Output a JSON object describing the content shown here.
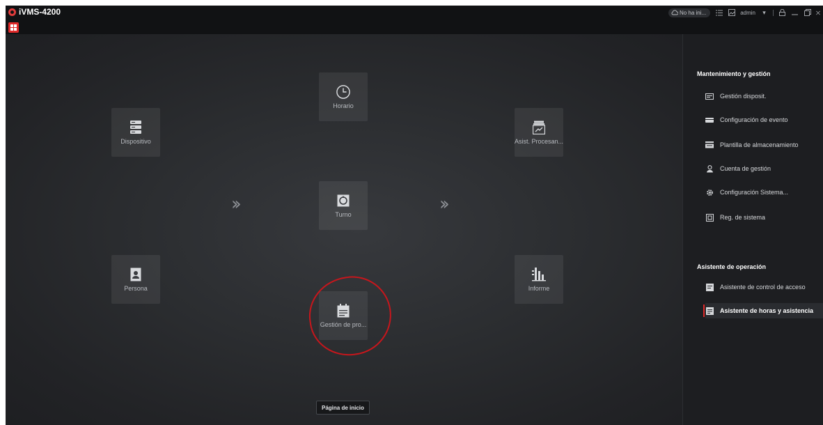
{
  "window": {
    "app_title": "iVMS-4200",
    "cloud_status": "No ha ini...",
    "user": "admin",
    "accent_color": "#e02a2a"
  },
  "modules": {
    "dispositivo": {
      "label": "Dispositivo",
      "icon": "server-icon"
    },
    "persona": {
      "label": "Persona",
      "icon": "person-card-icon"
    },
    "horario": {
      "label": "Horario",
      "icon": "clock-icon"
    },
    "turno": {
      "label": "Turno",
      "icon": "shift-icon"
    },
    "gestion_pro": {
      "label": "Gestión de pro...",
      "icon": "calendar-icon"
    },
    "asist_procesan": {
      "label": "Asist. Procesan...",
      "icon": "attendance-processing-icon"
    },
    "informe": {
      "label": "Informe",
      "icon": "report-chart-icon"
    }
  },
  "footer": {
    "home_page_label": "Página de inicio"
  },
  "panel": {
    "section1_title": "Mantenimiento y gestión",
    "section1_items": [
      {
        "label": "Gestión disposit.",
        "icon": "device-icon"
      },
      {
        "label": "Configuración de evento",
        "icon": "event-icon"
      },
      {
        "label": "Plantilla de almacenamiento",
        "icon": "storage-icon"
      },
      {
        "label": "Cuenta de gestión",
        "icon": "account-icon"
      },
      {
        "label": "Configuración Sistema...",
        "icon": "gear-icon"
      },
      {
        "label": "Reg. de sistema",
        "icon": "log-icon"
      }
    ],
    "section2_title": "Asistente de operación",
    "section2_items": [
      {
        "label": "Asistente de control de acceso",
        "icon": "access-control-icon"
      },
      {
        "label": "Asistente de horas y asistencia",
        "icon": "attendance-wizard-icon",
        "active": true
      }
    ]
  }
}
